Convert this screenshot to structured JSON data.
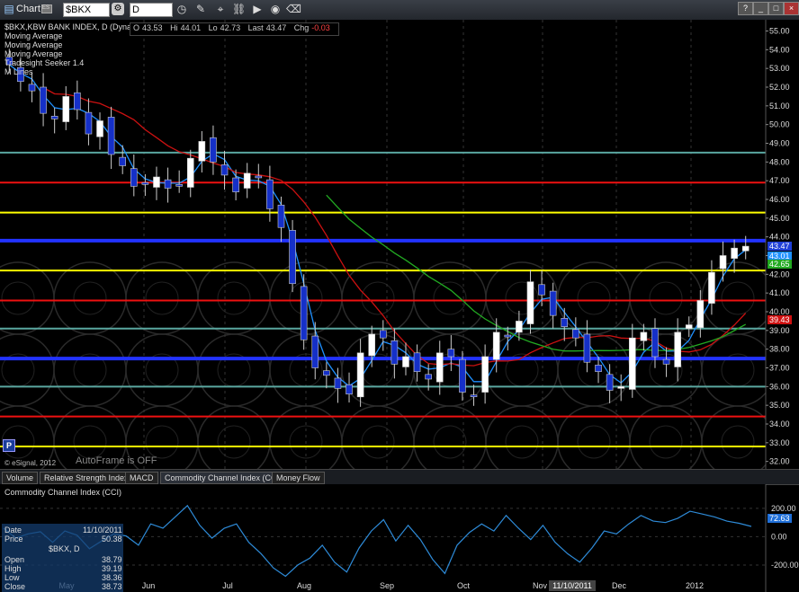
{
  "window": {
    "title": "Chart",
    "badge": "ES",
    "symbol": "$BKX",
    "interval": "D"
  },
  "quote": {
    "o_label": "O",
    "o": "43.53",
    "hi_label": "Hi",
    "hi": "44.01",
    "lo_label": "Lo",
    "lo": "42.73",
    "last_label": "Last",
    "last": "43.47",
    "chg_label": "Chg",
    "chg": "-0.03"
  },
  "studies": [
    "$BKX,KBW BANK INDEX, D (Dynamic)",
    "Moving Average",
    "Moving Average",
    "Moving Average",
    "Tradesight Seeker 1.4",
    "M Lines"
  ],
  "footer": {
    "copyright": "© eSignal, 2012",
    "autoframe": "AutoFrame is OFF",
    "p_button": "P"
  },
  "tabs": [
    "Volume",
    "Relative Strength Index",
    "MACD",
    "Commodity Channel Index (CCI)",
    "Money Flow"
  ],
  "lower_panel": {
    "title": "Commodity Channel Index (CCI)",
    "axis_labels": [
      "200.00",
      "0.00",
      "-200.00"
    ],
    "current_value": "72.63"
  },
  "cursor_window": {
    "date_label": "Date",
    "date": "11/10/2011",
    "price_label": "Price",
    "price": "50.38",
    "symbol": "$BKX, D",
    "open_label": "Open",
    "open": "38.79",
    "high_label": "High",
    "high": "39.19",
    "low_label": "Low",
    "low": "38.36",
    "close_label": "Close",
    "close": "38.73"
  },
  "price_tags": {
    "last": "43.47",
    "ma_fast": "43.01",
    "ma_mid": "42.65",
    "ma_slow": "39.43"
  },
  "x_labels": [
    "May",
    "Jun",
    "Jul",
    "Aug",
    "Sep",
    "Oct",
    "Nov",
    "11/10/2011",
    "Dec",
    "2012"
  ],
  "colors": {
    "yellow_line": "#ffff00",
    "red_line": "#ee1111",
    "blue_line": "#2233ff",
    "teal_line": "#5aa7a0",
    "ma_blue": "#1e90ff",
    "ma_red": "#cc1111",
    "ma_green": "#22aa22",
    "cci": "#2e8bd8"
  },
  "chart_data": {
    "type": "candlestick",
    "title": "$BKX,KBW BANK INDEX, D (Dynamic)",
    "y_ticks": [
      55,
      54,
      53,
      52,
      51,
      50,
      49,
      48,
      47,
      46,
      45,
      44,
      43,
      42,
      41,
      40,
      39,
      38,
      37,
      36,
      35,
      34,
      33,
      32
    ],
    "ylim": [
      31.6,
      55.6
    ],
    "x_labels": [
      "May",
      "Jun",
      "Jul",
      "Aug",
      "Sep",
      "Oct",
      "Nov",
      "Dec",
      "2012"
    ],
    "horizontal_lines": [
      {
        "color": "yellow",
        "value": 45.3
      },
      {
        "color": "yellow",
        "value": 42.2
      },
      {
        "color": "yellow",
        "value": 32.8
      },
      {
        "color": "red",
        "value": 46.9
      },
      {
        "color": "red",
        "value": 40.6
      },
      {
        "color": "red",
        "value": 34.4
      },
      {
        "color": "blue",
        "value": 43.8
      },
      {
        "color": "blue",
        "value": 37.5
      },
      {
        "color": "teal",
        "value": 48.5
      },
      {
        "color": "teal",
        "value": 39.1
      },
      {
        "color": "teal",
        "value": 36.0
      }
    ],
    "close_path": [
      53.2,
      52.3,
      51.8,
      50.6,
      50.3,
      51.5,
      50.8,
      49.5,
      50.2,
      48.4,
      47.8,
      46.7,
      46.8,
      47.2,
      46.6,
      46.8,
      48.2,
      49.1,
      48.0,
      47.3,
      46.4,
      47.4,
      47.2,
      45.5,
      44.5,
      41.5,
      38.5,
      37.0,
      36.6,
      35.9,
      35.6,
      37.8,
      38.8,
      38.6,
      37.2,
      37.6,
      36.8,
      36.4,
      37.8,
      37.6,
      35.7,
      35.5,
      37.6,
      38.9,
      38.7,
      39.5,
      41.6,
      40.9,
      39.8,
      39.2,
      38.6,
      37.3,
      36.8,
      35.8,
      36.0,
      38.6,
      38.9,
      37.6,
      37.2,
      38.9,
      39.3,
      40.6,
      42.1,
      43.0,
      43.4,
      43.5
    ],
    "last": 43.47,
    "ma_tags": [
      43.01,
      42.65,
      39.43
    ],
    "cci": {
      "title": "Commodity Channel Index (CCI)",
      "y_ticks": [
        200,
        0,
        -200
      ],
      "last": 72.63,
      "values": [
        60,
        -10,
        20,
        35,
        -40,
        40,
        10,
        -85,
        -30,
        20,
        5,
        -60,
        90,
        60,
        140,
        220,
        80,
        -10,
        60,
        90,
        -40,
        -120,
        -220,
        -280,
        -200,
        -150,
        -60,
        -180,
        -250,
        -80,
        40,
        120,
        -30,
        80,
        -20,
        -160,
        -260,
        -60,
        30,
        90,
        40,
        150,
        60,
        -20,
        80,
        -40,
        -120,
        -180,
        -80,
        40,
        20,
        90,
        150,
        110,
        100,
        130,
        180,
        160,
        140,
        110,
        95,
        72.63
      ]
    }
  }
}
